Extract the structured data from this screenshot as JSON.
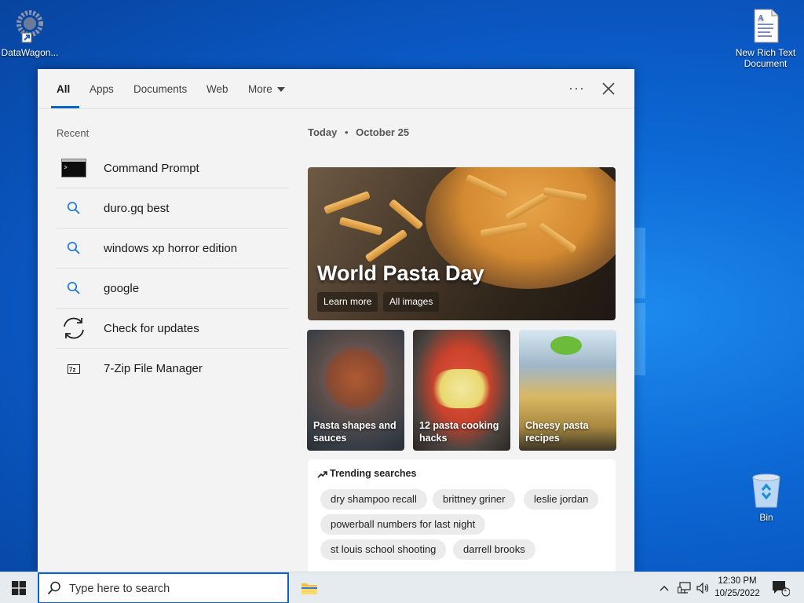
{
  "desktop": {
    "icons": [
      {
        "label": "DataWagon...",
        "icon": "gear-shortcut-icon"
      },
      {
        "label": "New Rich Text Document",
        "icon": "document-icon"
      },
      {
        "label": "Bin",
        "icon": "recycle-bin-icon"
      }
    ]
  },
  "search_panel": {
    "tabs": [
      "All",
      "Apps",
      "Documents",
      "Web",
      "More"
    ],
    "active_tab": "All",
    "recent_title": "Recent",
    "recent_items": [
      {
        "label": "Command Prompt",
        "icon": "command-prompt-icon"
      },
      {
        "label": "duro.gq best",
        "icon": "search-icon"
      },
      {
        "label": "windows xp horror edition",
        "icon": "search-icon"
      },
      {
        "label": "google",
        "icon": "search-icon"
      },
      {
        "label": "Check for updates",
        "icon": "refresh-icon"
      },
      {
        "label": "7-Zip File Manager",
        "icon": "7zip-icon"
      }
    ],
    "today_label": "Today",
    "date": "October 25",
    "hero": {
      "title": "World Pasta Day",
      "buttons": [
        "Learn more",
        "All images"
      ]
    },
    "cards": [
      {
        "caption": "Pasta shapes and sauces"
      },
      {
        "caption": "12 pasta cooking hacks"
      },
      {
        "caption": "Cheesy pasta recipes"
      }
    ],
    "trending": {
      "title": "Trending searches",
      "chips": [
        "dry shampoo recall",
        "brittney griner",
        "leslie jordan",
        "powerball numbers for last night",
        "st louis school shooting",
        "darrell brooks"
      ]
    }
  },
  "taskbar": {
    "search_placeholder": "Type here to search",
    "time": "12:30 PM",
    "date": "10/25/2022",
    "notification_count": "1"
  },
  "colors": {
    "accent": "#0b64c8",
    "desktop_bg": "#0a63d1",
    "panel_bg": "#f3f3f3"
  }
}
